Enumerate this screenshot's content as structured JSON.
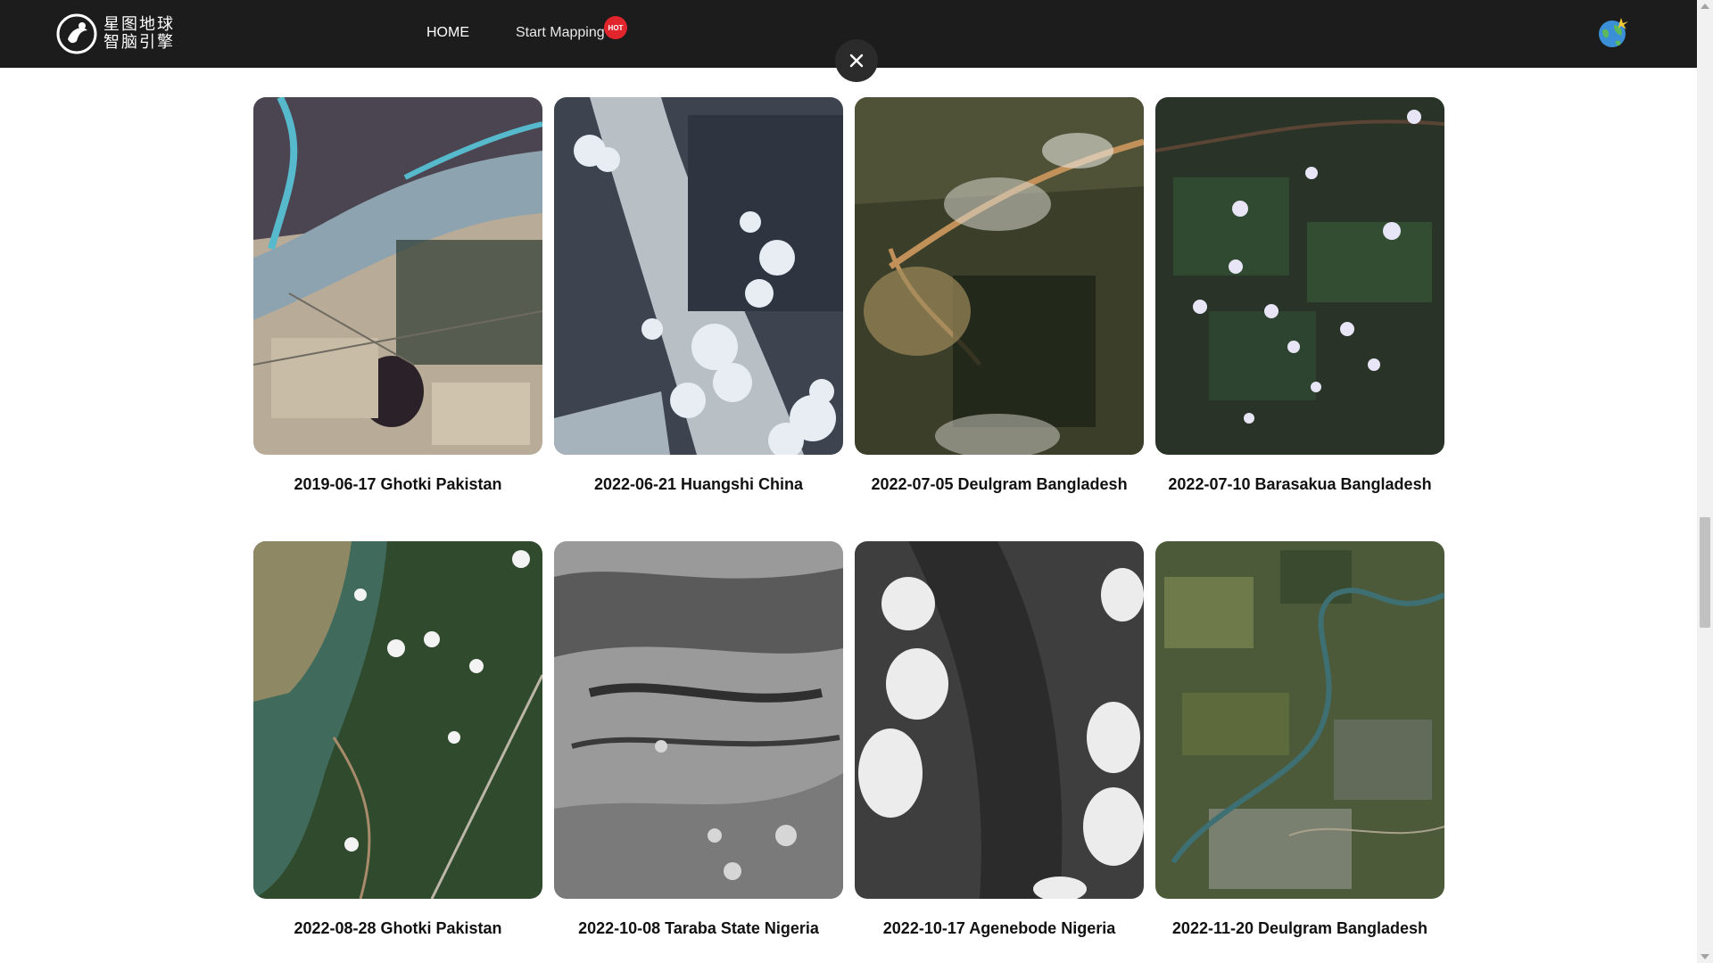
{
  "header": {
    "logo_line1": "星图地球",
    "logo_line2": "智脑引擎",
    "nav": {
      "home": "HOME",
      "start_mapping": "Start Mapping",
      "hot_badge": "HOT"
    }
  },
  "cards": [
    {
      "caption": "2019-06-17 Ghotki Pakistan"
    },
    {
      "caption": "2022-06-21 Huangshi China"
    },
    {
      "caption": "2022-07-05 Deulgram Bangladesh"
    },
    {
      "caption": "2022-07-10 Barasakua Bangladesh"
    },
    {
      "caption": "2022-08-28 Ghotki Pakistan"
    },
    {
      "caption": "2022-10-08 Taraba State Nigeria"
    },
    {
      "caption": "2022-10-17 Agenebode Nigeria"
    },
    {
      "caption": "2022-11-20 Deulgram Bangladesh"
    }
  ],
  "colors": {
    "header_bg": "#1c1c1c",
    "hot_badge": "#e0252c"
  }
}
